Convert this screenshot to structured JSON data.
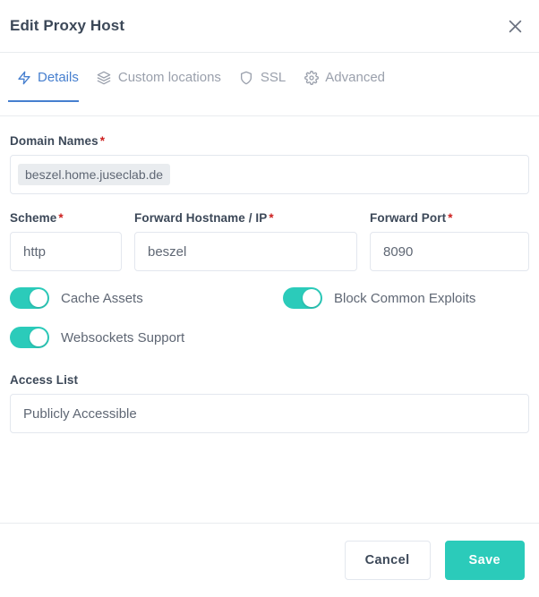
{
  "header": {
    "title": "Edit Proxy Host",
    "close_icon": "close-icon"
  },
  "tabs": [
    {
      "label": "Details",
      "icon": "lightning-bolt-icon",
      "active": true
    },
    {
      "label": "Custom locations",
      "icon": "layers-icon",
      "active": false
    },
    {
      "label": "SSL",
      "icon": "shield-icon",
      "active": false
    },
    {
      "label": "Advanced",
      "icon": "gear-icon",
      "active": false
    }
  ],
  "form": {
    "domain_names": {
      "label": "Domain Names",
      "required_marker": "*",
      "tags": [
        "beszel.home.juseclab.de"
      ]
    },
    "scheme": {
      "label": "Scheme",
      "required_marker": "*",
      "value": "http"
    },
    "forward_hostname": {
      "label": "Forward Hostname / IP",
      "required_marker": "*",
      "value": "beszel"
    },
    "forward_port": {
      "label": "Forward Port",
      "required_marker": "*",
      "value": "8090"
    },
    "toggles": [
      {
        "label": "Cache Assets",
        "on": true
      },
      {
        "label": "Block Common Exploits",
        "on": true
      },
      {
        "label": "Websockets Support",
        "on": true
      }
    ],
    "access_list": {
      "label": "Access List",
      "value": "Publicly Accessible"
    }
  },
  "footer": {
    "cancel_label": "Cancel",
    "save_label": "Save"
  },
  "colors": {
    "accent_teal": "#2bcbba",
    "accent_blue": "#467fcf",
    "required_red": "#cd201f",
    "text_dark": "#3c4858",
    "text_muted": "#9aa0ac",
    "border": "#e9ecef"
  }
}
